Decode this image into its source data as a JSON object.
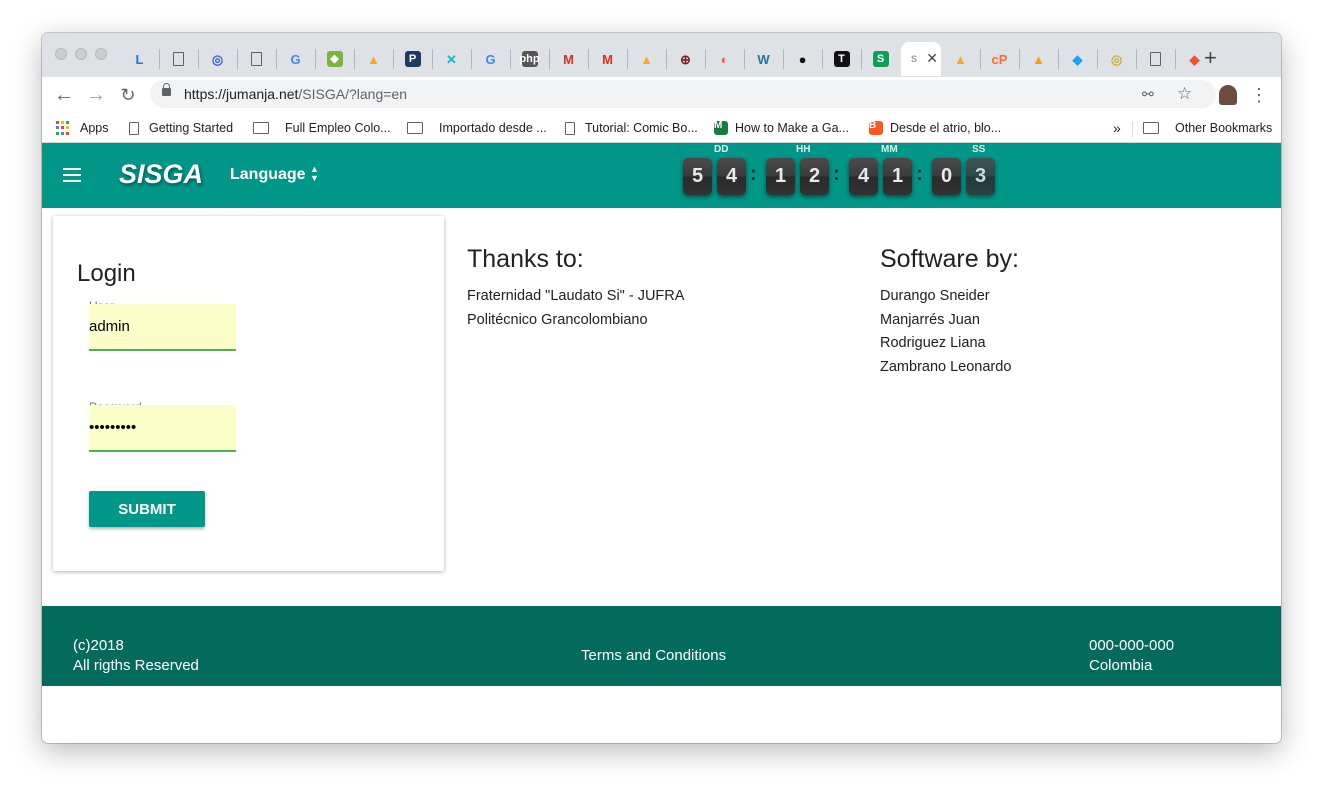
{
  "browser": {
    "tabs": [
      {
        "icon": "L-favicon",
        "color": "#1a73e8"
      },
      {
        "icon": "page-icon",
        "color": "#5f6368"
      },
      {
        "icon": "globe-blue-icon",
        "color": "#3b63c4"
      },
      {
        "icon": "page-icon",
        "color": "#5f6368"
      },
      {
        "icon": "google-icon",
        "color": "#4285f4"
      },
      {
        "icon": "green-shield-icon",
        "color": "#7cb342"
      },
      {
        "icon": "blue-yellow-icon",
        "color": "#f9a825"
      },
      {
        "icon": "P-favicon",
        "color": "#1e3a5f"
      },
      {
        "icon": "cyan-X-icon",
        "color": "#00bcd4"
      },
      {
        "icon": "google-icon",
        "color": "#4285f4"
      },
      {
        "icon": "php-icon",
        "color": "#555"
      },
      {
        "icon": "gmail-icon",
        "color": "#d93025"
      },
      {
        "icon": "gmail-icon",
        "color": "#d93025"
      },
      {
        "icon": "blue-yellow-icon",
        "color": "#f9a825"
      },
      {
        "icon": "globe-dark-icon",
        "color": "#7a1f1f"
      },
      {
        "icon": "orange-D-icon",
        "color": "#ff5722"
      },
      {
        "icon": "wordpress-icon",
        "color": "#21759b"
      },
      {
        "icon": "github-icon",
        "color": "#111"
      },
      {
        "icon": "T-favicon",
        "color": "#111"
      },
      {
        "icon": "S-favicon",
        "color": "#0f9d58"
      },
      {
        "icon": "sisga-icon",
        "color": "#009688",
        "active": true
      },
      {
        "icon": "blue-yellow-icon",
        "color": "#f9a825"
      },
      {
        "icon": "cpanel-icon",
        "color": "#ff6c2c"
      },
      {
        "icon": "pma-icon",
        "color": "#f4a300"
      },
      {
        "icon": "cyan-cube-icon",
        "color": "#1aa3e8"
      },
      {
        "icon": "yellow-ring-icon",
        "color": "#c9b037"
      },
      {
        "icon": "page-icon",
        "color": "#5f6368"
      },
      {
        "icon": "git-icon",
        "color": "#f05033"
      }
    ],
    "url_host": "https://jumanja.net",
    "url_path": "/SISGA/?lang=en",
    "bookmarks": [
      {
        "label": "Apps",
        "icon": "apps-grid-icon"
      },
      {
        "label": "Getting Started",
        "icon": "page-icon"
      },
      {
        "label": "Full Empleo Colo...",
        "icon": "folder-icon"
      },
      {
        "label": "Importado desde ...",
        "icon": "folder-icon"
      },
      {
        "label": "Tutorial: Comic Bo...",
        "icon": "page-icon"
      },
      {
        "label": "How to Make a Ga...",
        "icon": "green-M-icon"
      },
      {
        "label": "Desde el atrio, blo...",
        "icon": "blogger-icon"
      }
    ],
    "more_bookmarks": "»",
    "other_bookmarks": "Other Bookmarks"
  },
  "header": {
    "logo": "SISGA",
    "language_label": "Language"
  },
  "countdown": {
    "labels": {
      "days": "DD",
      "hours": "HH",
      "minutes": "MM",
      "seconds": "SS"
    },
    "digits": [
      "5",
      "4",
      "1",
      "2",
      "4",
      "1",
      "0",
      "3"
    ]
  },
  "login": {
    "title": "Login",
    "user_label": "User",
    "user_value": "admin",
    "password_label": "Password",
    "password_value": "•••••••••",
    "submit_label": "SUBMIT"
  },
  "thanks": {
    "title": "Thanks to:",
    "items": [
      "Fraternidad \"Laudato Si\" - JUFRA",
      "Politécnico Grancolombiano"
    ]
  },
  "software": {
    "title": "Software by:",
    "items": [
      "Durango Sneider",
      "Manjarrés Juan",
      "Rodriguez Liana",
      "Zambrano Leonardo"
    ]
  },
  "footer": {
    "copyright_line1": "(c)2018",
    "copyright_line2": "All rigths Reserved",
    "terms": "Terms and Conditions",
    "phone": "000-000-000",
    "country": "Colombia"
  },
  "colors": {
    "primary": "#009688",
    "footer_bg": "#036a5c",
    "autofill": "#fbfec9",
    "input_underline": "#4caf50"
  }
}
